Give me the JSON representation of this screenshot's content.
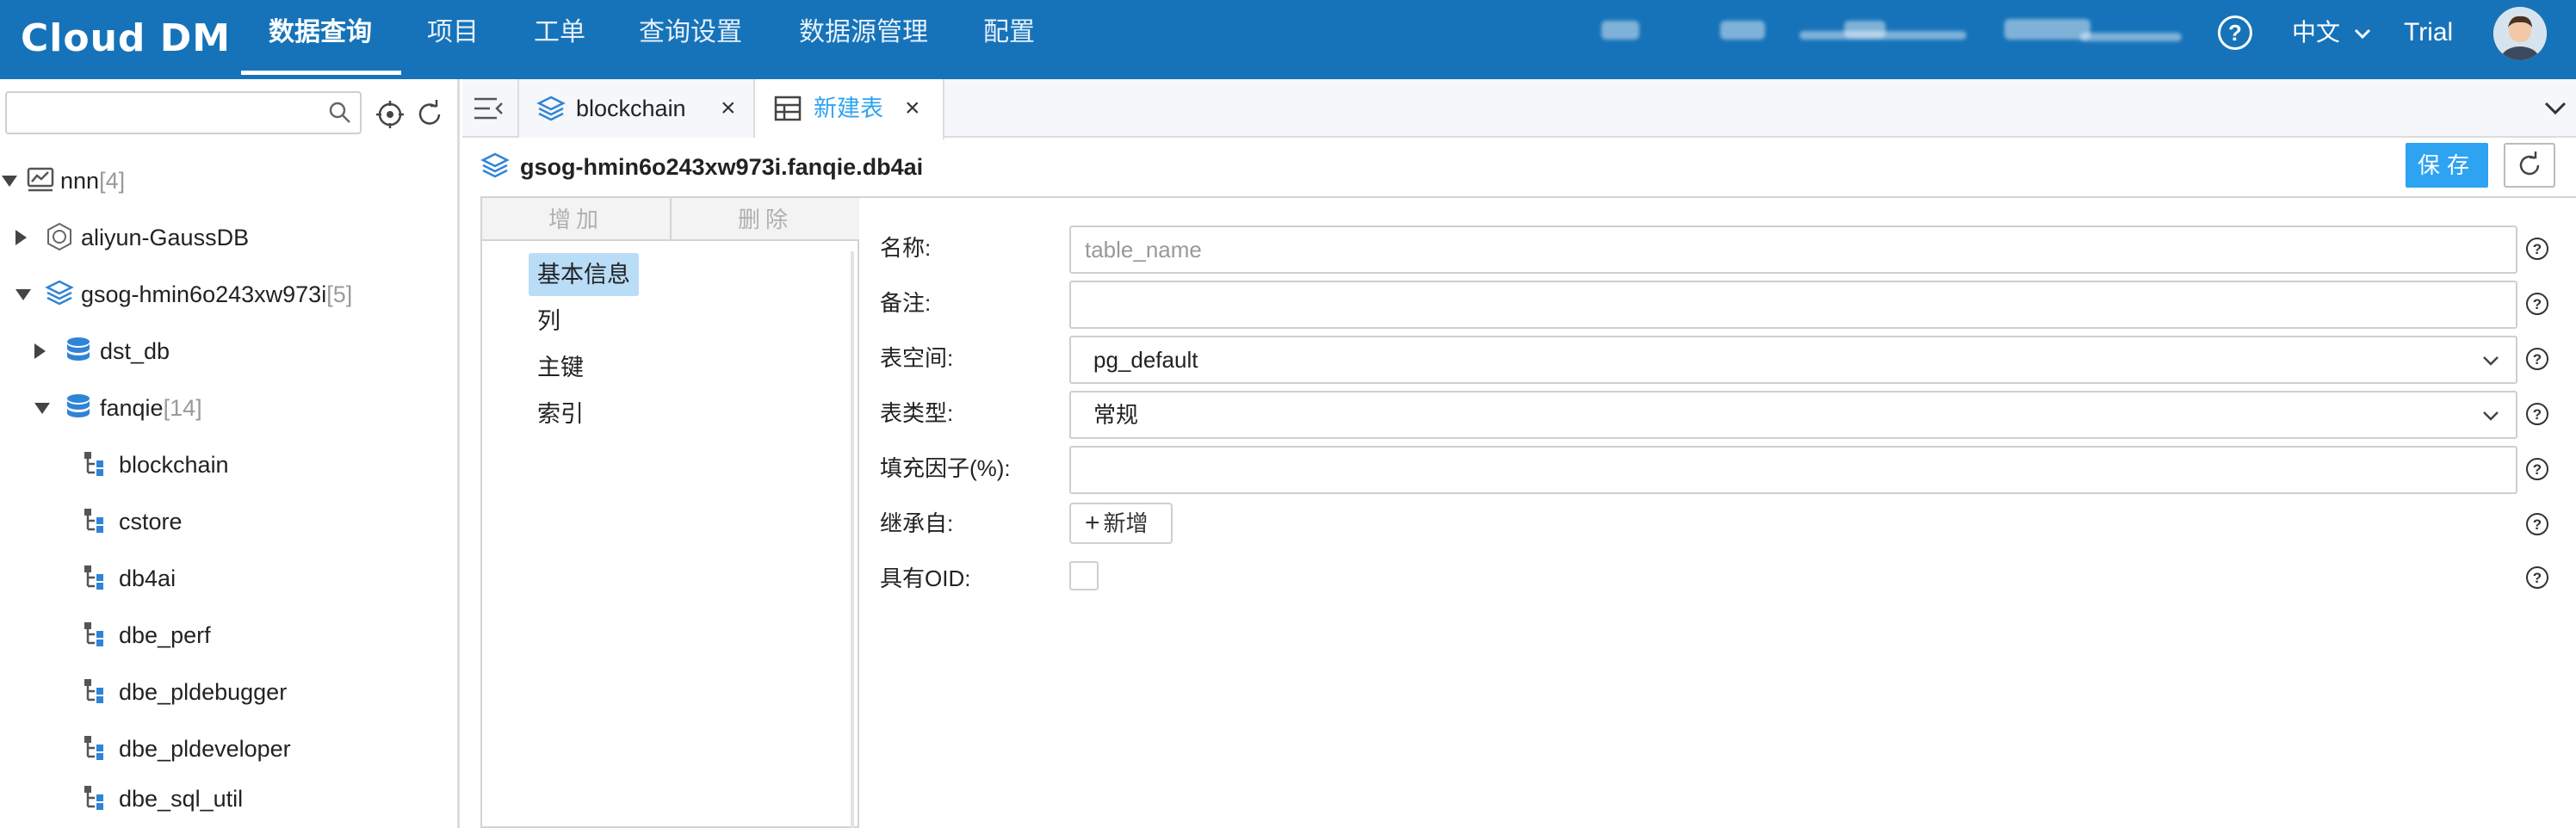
{
  "brand": {
    "logo_text": "Cloud DM"
  },
  "nav": {
    "items": [
      {
        "label": "数据查询"
      },
      {
        "label": "项目"
      },
      {
        "label": "工单"
      },
      {
        "label": "查询设置"
      },
      {
        "label": "数据源管理"
      },
      {
        "label": "配置"
      }
    ],
    "lang": "中文",
    "user": "Trial"
  },
  "sidebar": {
    "search_value": "",
    "tree": [
      {
        "label": "nnn",
        "count": "[4]"
      },
      {
        "label": "aliyun-GaussDB",
        "count": ""
      },
      {
        "label": "gsog-hmin6o243xw973i",
        "count": "[5]"
      },
      {
        "label": "dst_db",
        "count": ""
      },
      {
        "label": "fanqie",
        "count": "[14]"
      },
      {
        "label": "blockchain",
        "count": ""
      },
      {
        "label": "cstore",
        "count": ""
      },
      {
        "label": "db4ai",
        "count": ""
      },
      {
        "label": "dbe_perf",
        "count": ""
      },
      {
        "label": "dbe_pldebugger",
        "count": ""
      },
      {
        "label": "dbe_pldeveloper",
        "count": ""
      },
      {
        "label": "dbe_sql_util",
        "count": ""
      }
    ]
  },
  "tabs": [
    {
      "label": "blockchain"
    },
    {
      "label": "新建表"
    }
  ],
  "editor": {
    "object_path": "gsog-hmin6o243xw973i.fanqie.db4ai",
    "save_label": "保存",
    "add_label": "增加",
    "delete_label": "删除",
    "sections": [
      "基本信息",
      "列",
      "主键",
      "索引"
    ],
    "fields": {
      "name_label": "名称:",
      "name_placeholder": "table_name",
      "comment_label": "备注:",
      "comment_value": "",
      "tablespace_label": "表空间:",
      "tablespace_value": "pg_default",
      "tabletype_label": "表类型:",
      "tabletype_value": "常规",
      "fillfactor_label": "填充因子(%):",
      "fillfactor_value": "",
      "inherit_label": "继承自:",
      "inherit_add_label": "新增",
      "oid_label": "具有OID:"
    }
  },
  "colors": {
    "nav_bg": "#1673b9",
    "accent": "#2ea3f2",
    "active_tab_text": "#2ea3f2",
    "selected_section_bg": "#b9dcf7",
    "db_icon": "#2f84d6",
    "count_gray": "#9a9a9a"
  }
}
